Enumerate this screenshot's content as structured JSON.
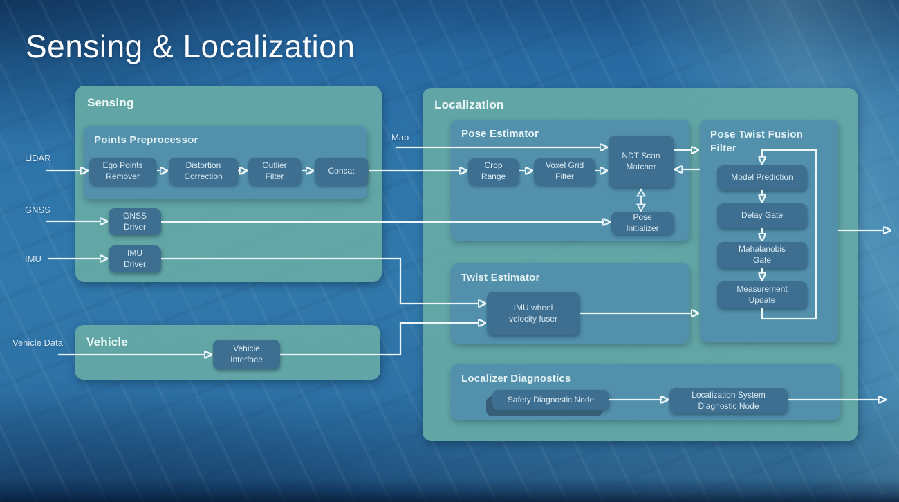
{
  "title": "Sensing & Localization",
  "labels": {
    "lidar": "LiDAR",
    "gnss": "GNSS",
    "imu": "IMU",
    "vehicle_data": "Vehicle Data",
    "map": "Map"
  },
  "sensing": {
    "title": "Sensing",
    "points_preprocessor": {
      "title": "Points Preprocessor",
      "ego_points_remover": "Ego Points Remover",
      "distortion_correction": "Distortion Correction",
      "outlier_filter": "Outlier Filter",
      "concat": "Concat"
    },
    "gnss_driver": "GNSS Driver",
    "imu_driver": "IMU Driver"
  },
  "vehicle": {
    "title": "Vehicle",
    "vehicle_interface": "Vehicle Interface"
  },
  "localization": {
    "title": "Localization",
    "pose_estimator": {
      "title": "Pose Estimator",
      "crop_range": "Crop Range",
      "voxel_grid_filter": "Voxel Grid Filter",
      "ndt_scan_matcher": "NDT Scan Matcher",
      "pose_initializer": "Pose Initializer"
    },
    "twist_estimator": {
      "title": "Twist Estimator",
      "imu_wheel_velocity_fuser": "IMU wheel velocity fuser"
    },
    "pose_twist_fusion_filter": {
      "title": "Pose Twist Fusion Filter",
      "model_prediction": "Model Prediction",
      "delay_gate": "Delay Gate",
      "mahalanobis_gate": "Mahalanobis Gate",
      "measurement_update": "Measurement Update"
    },
    "localizer_diagnostics": {
      "title": "Localizer Diagnostics",
      "safety_diagnostic_node": "Safety Diagnostic Node",
      "localization_system_diagnostic_node": "Localization System Diagnostic Node"
    }
  },
  "colors": {
    "background_blue": "#2e74a9",
    "panel_teal": "#64a8a6",
    "subpanel_blue": "#528fac",
    "block_blue": "#3e6e90",
    "arrow_white": "#edf6f9",
    "title_text": "#fdfeff"
  }
}
